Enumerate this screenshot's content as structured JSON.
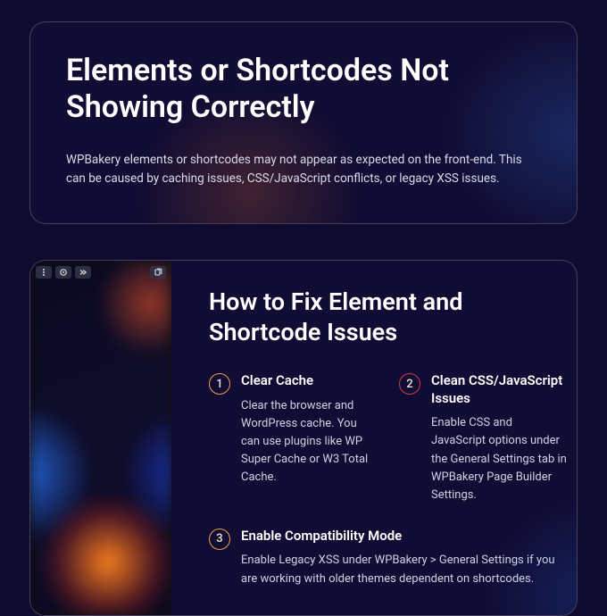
{
  "intro": {
    "title": "Elements or Shortcodes Not Showing Correctly",
    "body": "WPBakery elements or shortcodes may not appear as expected on the front-end. This can be caused by caching issues, CSS/JavaScript conflicts, or legacy XSS issues."
  },
  "fix": {
    "title": "How to Fix Element and Shortcode Issues",
    "steps": [
      {
        "num": "1",
        "title": "Clear Cache",
        "body": "Clear the browser and WordPress cache. You can use plugins like WP Super Cache or W3 Total Cache."
      },
      {
        "num": "2",
        "title": "Clean CSS/JavaScript Issues",
        "body": "Enable CSS and JavaScript options under the General Settings tab in WPBakery Page Builder Settings."
      },
      {
        "num": "3",
        "title": "Enable Compatibility Mode",
        "body": "Enable Legacy XSS under WPBakery > General Settings if you are working with older themes dependent on shortcodes."
      }
    ]
  }
}
